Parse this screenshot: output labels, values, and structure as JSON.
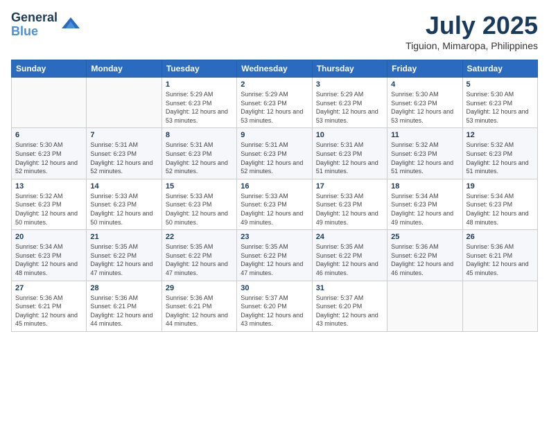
{
  "header": {
    "logo_line1": "General",
    "logo_line2": "Blue",
    "month": "July 2025",
    "location": "Tiguion, Mimaropa, Philippines"
  },
  "weekdays": [
    "Sunday",
    "Monday",
    "Tuesday",
    "Wednesday",
    "Thursday",
    "Friday",
    "Saturday"
  ],
  "weeks": [
    [
      {
        "day": "",
        "sunrise": "",
        "sunset": "",
        "daylight": ""
      },
      {
        "day": "",
        "sunrise": "",
        "sunset": "",
        "daylight": ""
      },
      {
        "day": "1",
        "sunrise": "Sunrise: 5:29 AM",
        "sunset": "Sunset: 6:23 PM",
        "daylight": "Daylight: 12 hours and 53 minutes."
      },
      {
        "day": "2",
        "sunrise": "Sunrise: 5:29 AM",
        "sunset": "Sunset: 6:23 PM",
        "daylight": "Daylight: 12 hours and 53 minutes."
      },
      {
        "day": "3",
        "sunrise": "Sunrise: 5:29 AM",
        "sunset": "Sunset: 6:23 PM",
        "daylight": "Daylight: 12 hours and 53 minutes."
      },
      {
        "day": "4",
        "sunrise": "Sunrise: 5:30 AM",
        "sunset": "Sunset: 6:23 PM",
        "daylight": "Daylight: 12 hours and 53 minutes."
      },
      {
        "day": "5",
        "sunrise": "Sunrise: 5:30 AM",
        "sunset": "Sunset: 6:23 PM",
        "daylight": "Daylight: 12 hours and 53 minutes."
      }
    ],
    [
      {
        "day": "6",
        "sunrise": "Sunrise: 5:30 AM",
        "sunset": "Sunset: 6:23 PM",
        "daylight": "Daylight: 12 hours and 52 minutes."
      },
      {
        "day": "7",
        "sunrise": "Sunrise: 5:31 AM",
        "sunset": "Sunset: 6:23 PM",
        "daylight": "Daylight: 12 hours and 52 minutes."
      },
      {
        "day": "8",
        "sunrise": "Sunrise: 5:31 AM",
        "sunset": "Sunset: 6:23 PM",
        "daylight": "Daylight: 12 hours and 52 minutes."
      },
      {
        "day": "9",
        "sunrise": "Sunrise: 5:31 AM",
        "sunset": "Sunset: 6:23 PM",
        "daylight": "Daylight: 12 hours and 52 minutes."
      },
      {
        "day": "10",
        "sunrise": "Sunrise: 5:31 AM",
        "sunset": "Sunset: 6:23 PM",
        "daylight": "Daylight: 12 hours and 51 minutes."
      },
      {
        "day": "11",
        "sunrise": "Sunrise: 5:32 AM",
        "sunset": "Sunset: 6:23 PM",
        "daylight": "Daylight: 12 hours and 51 minutes."
      },
      {
        "day": "12",
        "sunrise": "Sunrise: 5:32 AM",
        "sunset": "Sunset: 6:23 PM",
        "daylight": "Daylight: 12 hours and 51 minutes."
      }
    ],
    [
      {
        "day": "13",
        "sunrise": "Sunrise: 5:32 AM",
        "sunset": "Sunset: 6:23 PM",
        "daylight": "Daylight: 12 hours and 50 minutes."
      },
      {
        "day": "14",
        "sunrise": "Sunrise: 5:33 AM",
        "sunset": "Sunset: 6:23 PM",
        "daylight": "Daylight: 12 hours and 50 minutes."
      },
      {
        "day": "15",
        "sunrise": "Sunrise: 5:33 AM",
        "sunset": "Sunset: 6:23 PM",
        "daylight": "Daylight: 12 hours and 50 minutes."
      },
      {
        "day": "16",
        "sunrise": "Sunrise: 5:33 AM",
        "sunset": "Sunset: 6:23 PM",
        "daylight": "Daylight: 12 hours and 49 minutes."
      },
      {
        "day": "17",
        "sunrise": "Sunrise: 5:33 AM",
        "sunset": "Sunset: 6:23 PM",
        "daylight": "Daylight: 12 hours and 49 minutes."
      },
      {
        "day": "18",
        "sunrise": "Sunrise: 5:34 AM",
        "sunset": "Sunset: 6:23 PM",
        "daylight": "Daylight: 12 hours and 49 minutes."
      },
      {
        "day": "19",
        "sunrise": "Sunrise: 5:34 AM",
        "sunset": "Sunset: 6:23 PM",
        "daylight": "Daylight: 12 hours and 48 minutes."
      }
    ],
    [
      {
        "day": "20",
        "sunrise": "Sunrise: 5:34 AM",
        "sunset": "Sunset: 6:23 PM",
        "daylight": "Daylight: 12 hours and 48 minutes."
      },
      {
        "day": "21",
        "sunrise": "Sunrise: 5:35 AM",
        "sunset": "Sunset: 6:22 PM",
        "daylight": "Daylight: 12 hours and 47 minutes."
      },
      {
        "day": "22",
        "sunrise": "Sunrise: 5:35 AM",
        "sunset": "Sunset: 6:22 PM",
        "daylight": "Daylight: 12 hours and 47 minutes."
      },
      {
        "day": "23",
        "sunrise": "Sunrise: 5:35 AM",
        "sunset": "Sunset: 6:22 PM",
        "daylight": "Daylight: 12 hours and 47 minutes."
      },
      {
        "day": "24",
        "sunrise": "Sunrise: 5:35 AM",
        "sunset": "Sunset: 6:22 PM",
        "daylight": "Daylight: 12 hours and 46 minutes."
      },
      {
        "day": "25",
        "sunrise": "Sunrise: 5:36 AM",
        "sunset": "Sunset: 6:22 PM",
        "daylight": "Daylight: 12 hours and 46 minutes."
      },
      {
        "day": "26",
        "sunrise": "Sunrise: 5:36 AM",
        "sunset": "Sunset: 6:21 PM",
        "daylight": "Daylight: 12 hours and 45 minutes."
      }
    ],
    [
      {
        "day": "27",
        "sunrise": "Sunrise: 5:36 AM",
        "sunset": "Sunset: 6:21 PM",
        "daylight": "Daylight: 12 hours and 45 minutes."
      },
      {
        "day": "28",
        "sunrise": "Sunrise: 5:36 AM",
        "sunset": "Sunset: 6:21 PM",
        "daylight": "Daylight: 12 hours and 44 minutes."
      },
      {
        "day": "29",
        "sunrise": "Sunrise: 5:36 AM",
        "sunset": "Sunset: 6:21 PM",
        "daylight": "Daylight: 12 hours and 44 minutes."
      },
      {
        "day": "30",
        "sunrise": "Sunrise: 5:37 AM",
        "sunset": "Sunset: 6:20 PM",
        "daylight": "Daylight: 12 hours and 43 minutes."
      },
      {
        "day": "31",
        "sunrise": "Sunrise: 5:37 AM",
        "sunset": "Sunset: 6:20 PM",
        "daylight": "Daylight: 12 hours and 43 minutes."
      },
      {
        "day": "",
        "sunrise": "",
        "sunset": "",
        "daylight": ""
      },
      {
        "day": "",
        "sunrise": "",
        "sunset": "",
        "daylight": ""
      }
    ]
  ]
}
